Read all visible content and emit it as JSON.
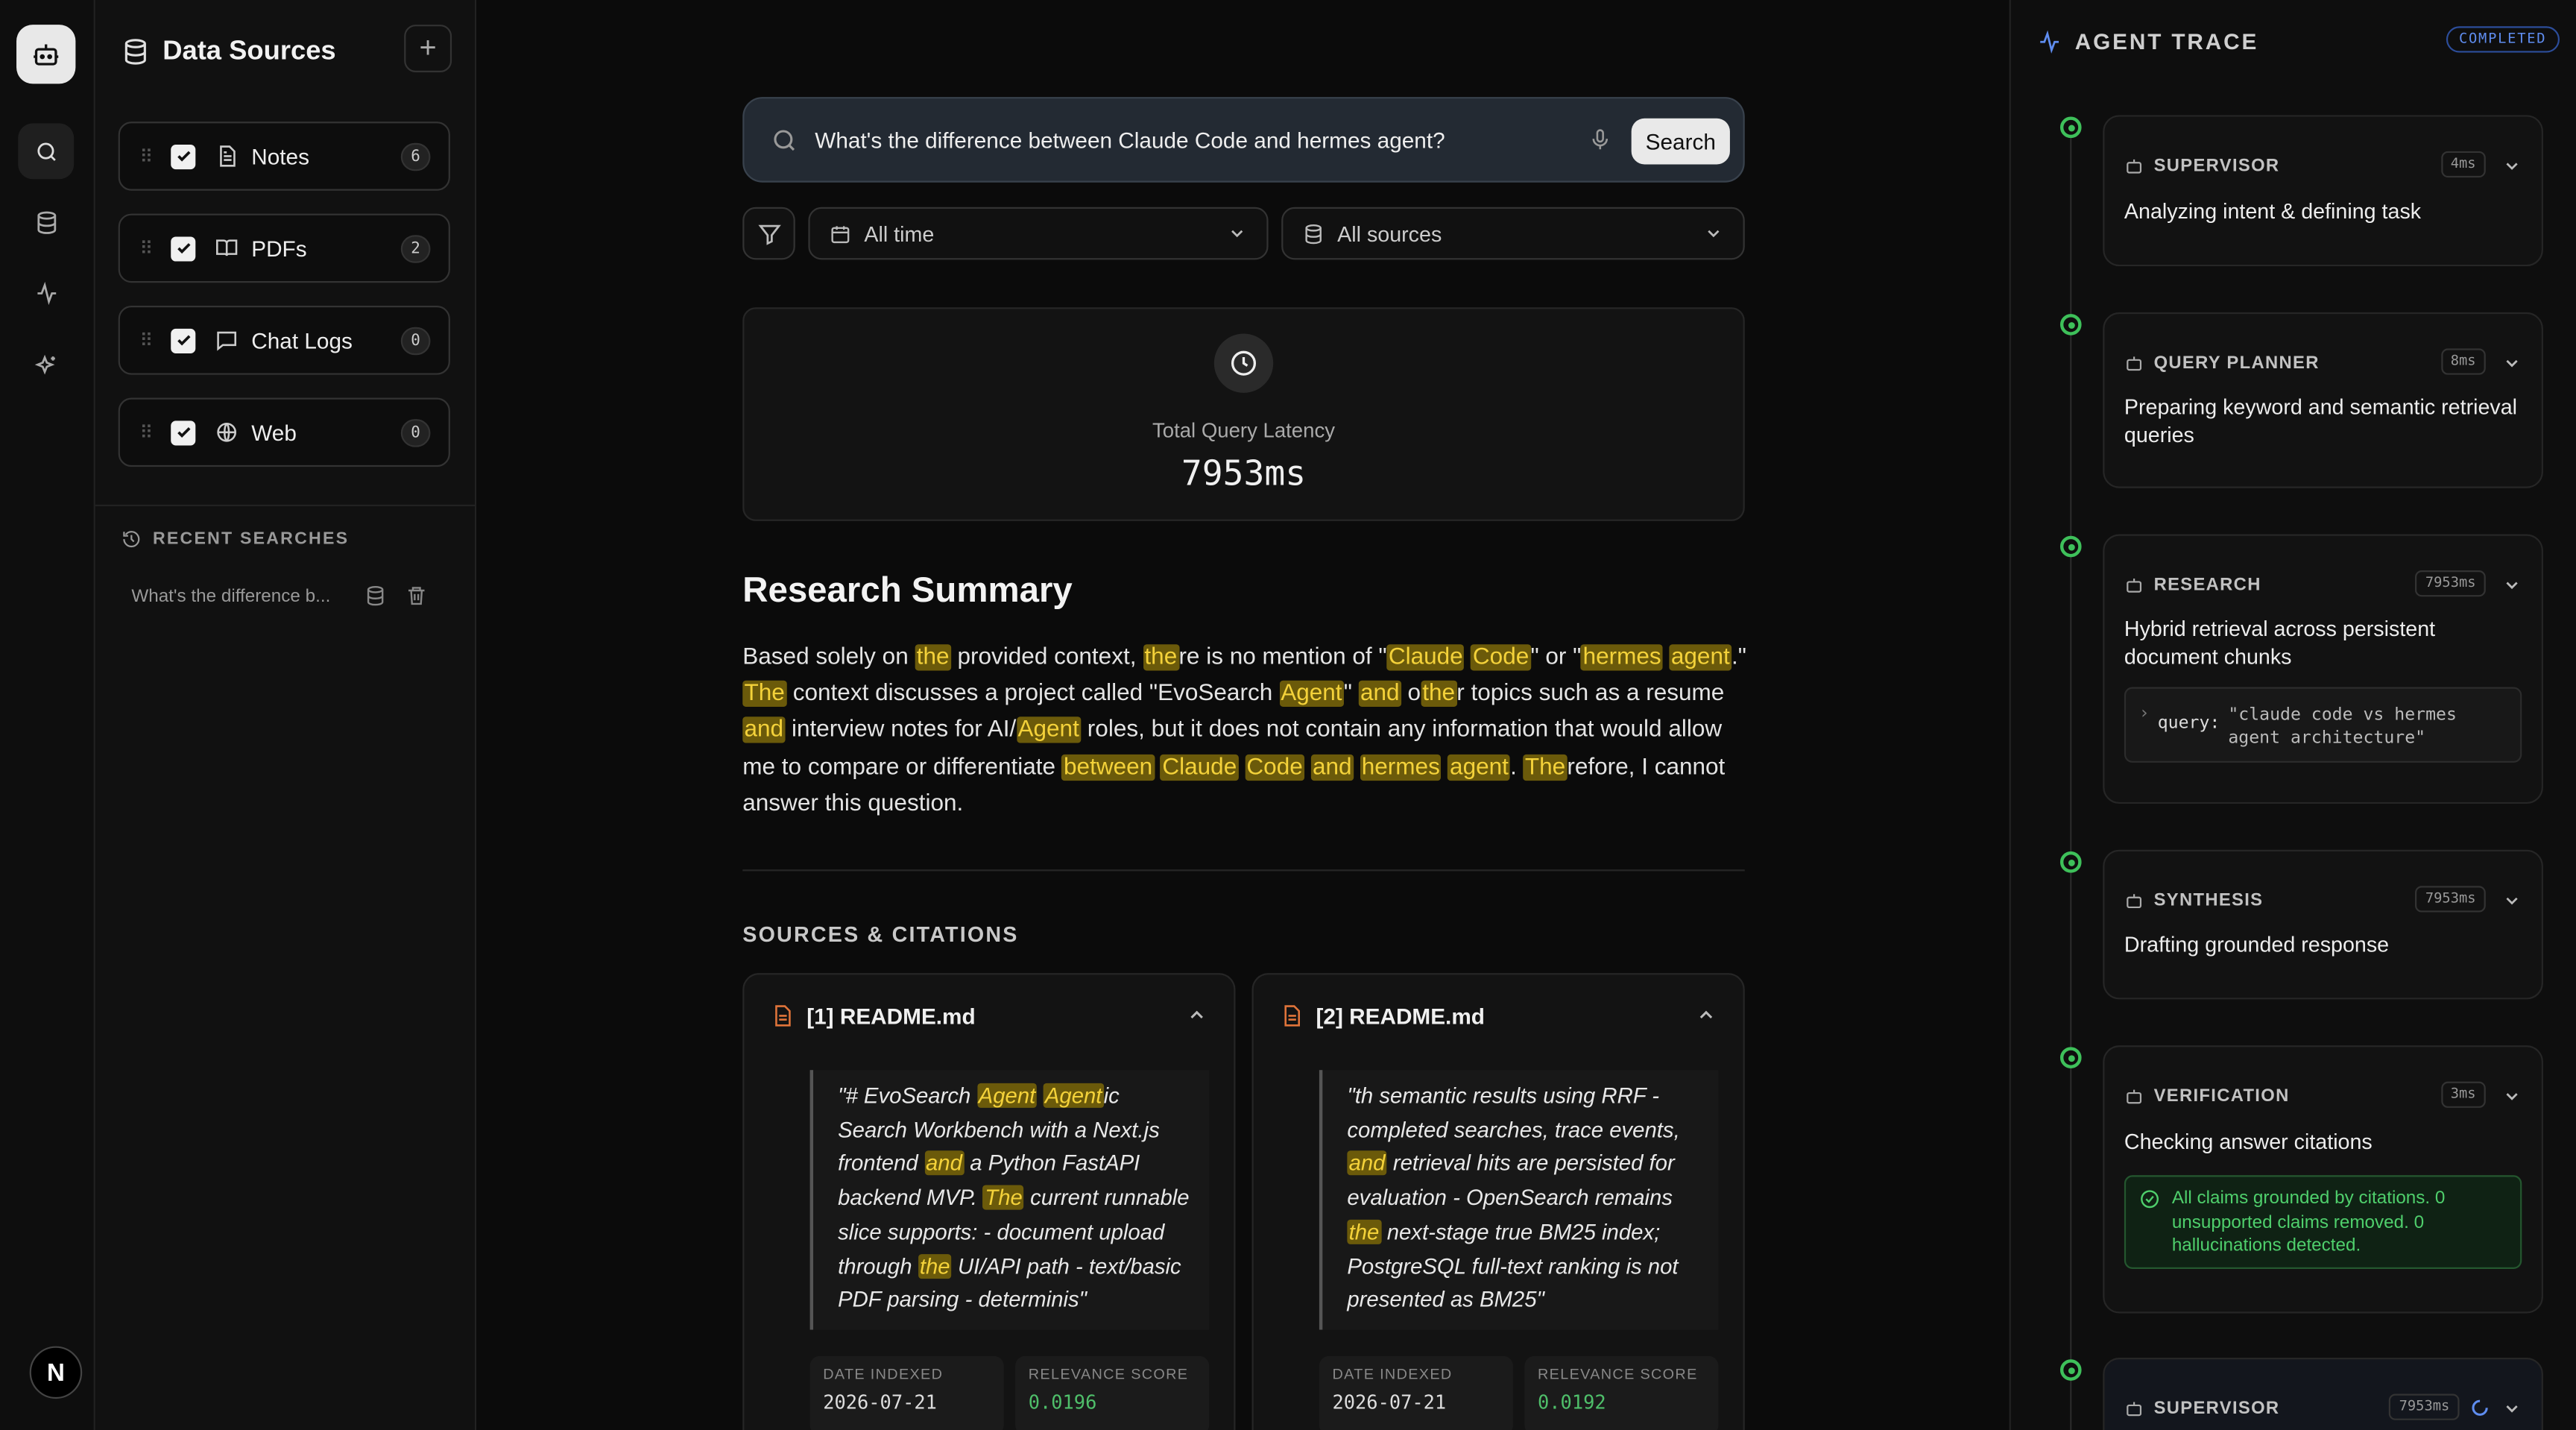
{
  "data_sources": {
    "title": "Data Sources",
    "add_label": "+",
    "items": [
      {
        "label": "Notes",
        "count": "6",
        "icon": "file-text-icon",
        "checked": true
      },
      {
        "label": "PDFs",
        "count": "2",
        "icon": "book-icon",
        "checked": true
      },
      {
        "label": "Chat Logs",
        "count": "0",
        "icon": "message-icon",
        "checked": true
      },
      {
        "label": "Web",
        "count": "0",
        "icon": "globe-icon",
        "checked": true
      }
    ],
    "recent_heading": "RECENT SEARCHES",
    "recent": [
      "What's the difference b..."
    ]
  },
  "search": {
    "query": "What's the difference between Claude Code and hermes agent?",
    "button": "Search",
    "time_filter": "All time",
    "source_filter": "All sources"
  },
  "latency": {
    "label": "Total Query Latency",
    "value": "7953ms"
  },
  "summary": {
    "title": "Research Summary"
  },
  "sources": {
    "heading": "SOURCES & CITATIONS",
    "cards": [
      {
        "title": "[1] README.md",
        "date_label": "DATE INDEXED",
        "date": "2026-07-21",
        "score_label": "RELEVANCE SCORE",
        "score": "0.0196"
      },
      {
        "title": "[2] README.md",
        "date_label": "DATE INDEXED",
        "date": "2026-07-21",
        "score_label": "RELEVANCE SCORE",
        "score": "0.0192"
      }
    ]
  },
  "trace": {
    "title": "AGENT TRACE",
    "status": "COMPLETED",
    "steps": [
      {
        "name": "SUPERVISOR",
        "ms": "4ms",
        "desc": "Analyzing intent & defining task"
      },
      {
        "name": "QUERY PLANNER",
        "ms": "8ms",
        "desc": "Preparing keyword and semantic retrieval queries"
      },
      {
        "name": "RESEARCH",
        "ms": "7953ms",
        "desc": "Hybrid retrieval across persistent document chunks",
        "query_key": "query:",
        "query_val": "\"claude code vs hermes agent architecture\""
      },
      {
        "name": "SYNTHESIS",
        "ms": "7953ms",
        "desc": "Drafting grounded response"
      },
      {
        "name": "VERIFICATION",
        "ms": "3ms",
        "desc": "Checking answer citations",
        "verify": "All claims grounded by citations. 0 unsupported claims removed. 0 hallucinations detected."
      },
      {
        "name": "SUPERVISOR",
        "ms": "7953ms"
      }
    ]
  },
  "colors": {
    "highlight": "#6b5a0a",
    "highlight_text": "#f4d23a",
    "success": "#3ec05a",
    "accent_blue": "#5f8df0"
  }
}
